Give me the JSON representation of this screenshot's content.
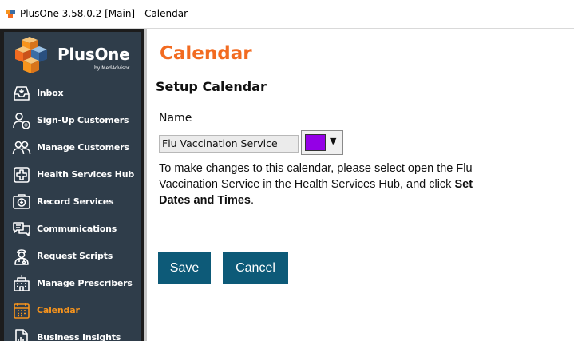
{
  "window": {
    "title": "PlusOne 3.58.0.2 [Main] - Calendar",
    "icon": "plusone-app-icon"
  },
  "sidebar": {
    "logo": {
      "name": "PlusOne",
      "subtext": "by MedAdvisor"
    },
    "items": [
      {
        "label": "Inbox",
        "icon": "inbox-icon",
        "active": false
      },
      {
        "label": "Sign-Up Customers",
        "icon": "add-user-icon",
        "active": false
      },
      {
        "label": "Manage Customers",
        "icon": "users-icon",
        "active": false
      },
      {
        "label": "Health Services Hub",
        "icon": "health-plus-icon",
        "active": false
      },
      {
        "label": "Record Services",
        "icon": "record-services-icon",
        "active": false
      },
      {
        "label": "Communications",
        "icon": "chat-bubbles-icon",
        "active": false
      },
      {
        "label": "Request Scripts",
        "icon": "doctor-icon",
        "active": false
      },
      {
        "label": "Manage Prescribers",
        "icon": "building-icon",
        "active": false
      },
      {
        "label": "Calendar",
        "icon": "calendar-icon",
        "active": true
      },
      {
        "label": "Business Insights",
        "icon": "document-chart-icon",
        "active": false
      }
    ]
  },
  "main": {
    "title": "Calendar",
    "section_title": "Setup Calendar",
    "name_label": "Name",
    "name_value": "Flu Vaccination Service",
    "calendar_color": "#9400e6",
    "info_text_before": "To make changes to this calendar, please select open the Flu Vaccination Service in the Health Services Hub, and click ",
    "info_text_bold": "Set Dates and Times",
    "info_text_after": ".",
    "save_label": "Save",
    "cancel_label": "Cancel"
  },
  "colors": {
    "accent": "#f26b21",
    "sidebar_bg": "#2f3d4a",
    "active_nav": "#f7941d",
    "button_bg": "#0d5a78"
  }
}
